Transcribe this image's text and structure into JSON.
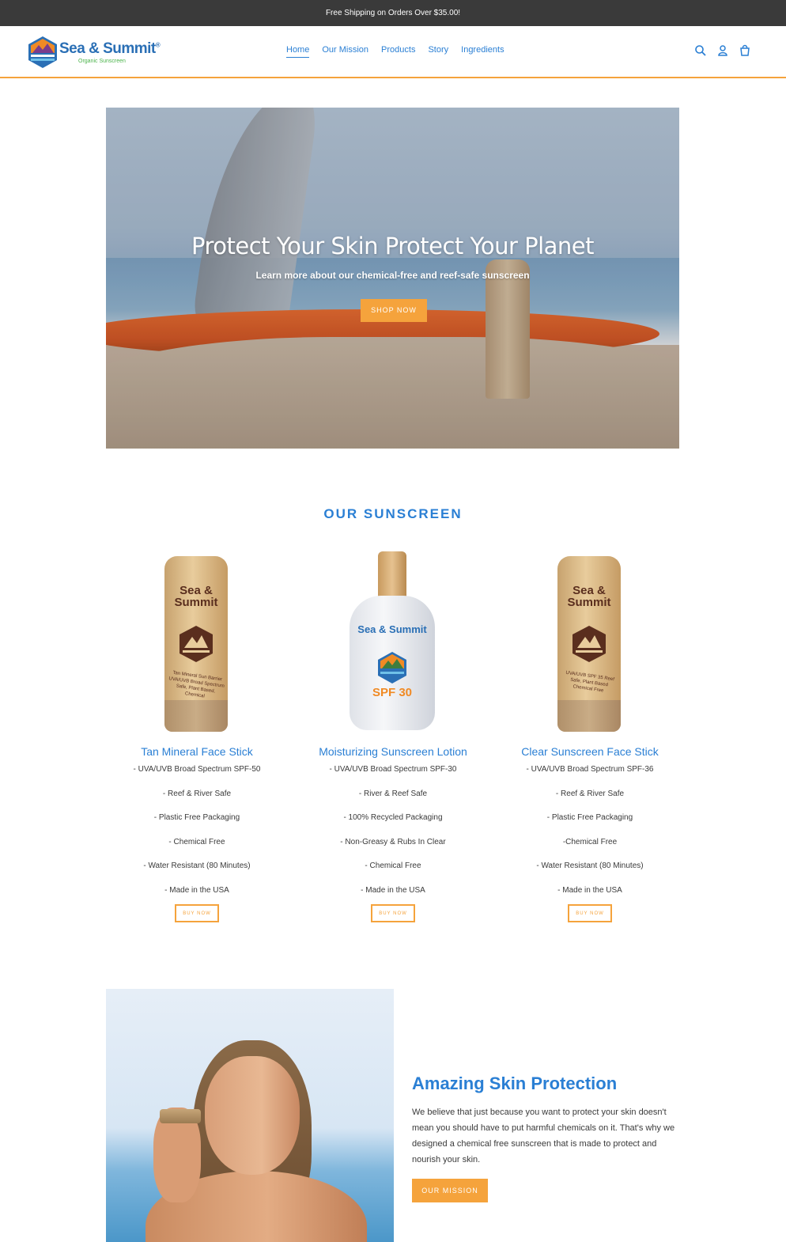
{
  "announcement": "Free Shipping on Orders Over $35.00!",
  "brand": {
    "name": "Sea & Summit",
    "reg": "®",
    "tagline": "Organic Sunscreen"
  },
  "nav": [
    {
      "label": "Home",
      "active": true
    },
    {
      "label": "Our Mission"
    },
    {
      "label": "Products"
    },
    {
      "label": "Story"
    },
    {
      "label": "Ingredients"
    }
  ],
  "header_icons": [
    "search-icon",
    "account-icon",
    "cart-icon"
  ],
  "hero": {
    "title": "Protect Your Skin Protect Your Planet",
    "subtitle": "Learn more about our chemical-free and reef-safe sunscreen",
    "button": "SHOP NOW"
  },
  "products_section": {
    "title": "OUR SUNSCREEN",
    "products": [
      {
        "name": "Tan Mineral Face Stick",
        "image_brand": "Sea & Summit",
        "image_text": "Tan Mineral Sun Barrier UVA/UVB Broad Spectrum Safe, Plant Based, Chemical",
        "features": [
          "- UVA/UVB Broad Spectrum SPF-50",
          "- Reef & River Safe",
          "- Plastic Free Packaging",
          "- Chemical Free",
          "- Water Resistant (80 Minutes)",
          "- Made in the USA"
        ],
        "button": "BUY NOW"
      },
      {
        "name": "Moisturizing Sunscreen Lotion",
        "image_brand": "Sea & Summit",
        "image_spf": "SPF 30",
        "features": [
          "- UVA/UVB Broad Spectrum SPF-30",
          "- River & Reef Safe",
          "- 100% Recycled Packaging",
          "- Non-Greasy & Rubs In Clear",
          "- Chemical Free",
          "- Made in the USA"
        ],
        "button": "BUY NOW"
      },
      {
        "name": "Clear Sunscreen Face Stick",
        "image_brand": "Sea & Summit",
        "image_text": "UVA/UVB SPF 35 Reef Safe, Plant Based Chemical Free",
        "features": [
          "- UVA/UVB Broad Spectrum SPF-36",
          "- Reef & River Safe",
          "- Plastic Free Packaging",
          "-Chemical Free",
          "- Water Resistant (80 Minutes)",
          "- Made in the USA"
        ],
        "button": "BUY NOW"
      }
    ]
  },
  "feature_split": {
    "title": "Amazing Skin Protection",
    "body": "We believe that just because you want to protect your skin doesn't mean you should have to put harmful chemicals on it. That's why we designed a chemical free sunscreen that is made to protect and nourish your skin.",
    "button": "OUR MISSION"
  },
  "colors": {
    "accent": "#f5a33c",
    "link": "#2a7fd4",
    "announcement_bg": "#3a3a3a"
  }
}
